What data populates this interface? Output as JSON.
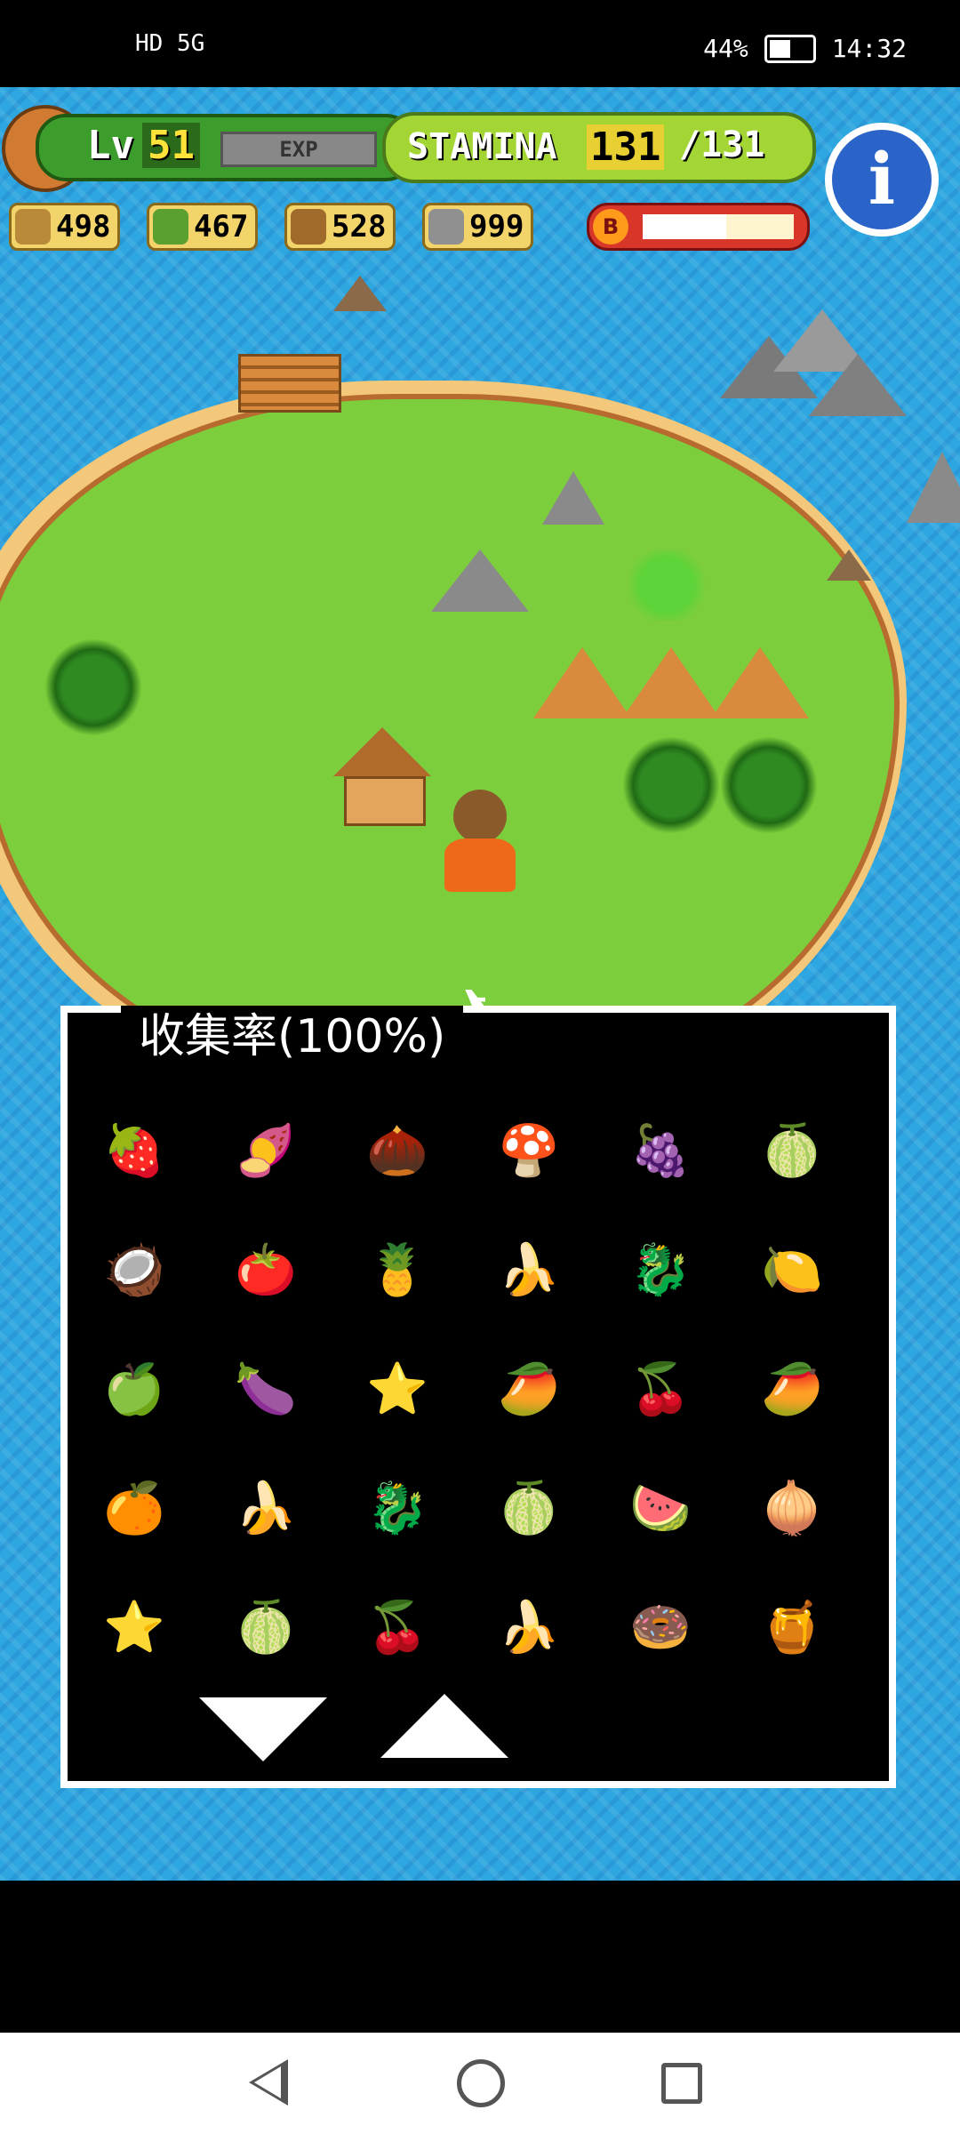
{
  "status_bar": {
    "left_indicators": "HD 5G",
    "battery": "44%",
    "time": "14:32"
  },
  "hud": {
    "level_label": "Lv",
    "level_value": "51",
    "exp_label": "EXP",
    "stamina_label": "STAMINA",
    "stamina_current": "131",
    "stamina_max": "/131",
    "boost_letter": "B",
    "boost_fill_fraction": 0.55,
    "resources": [
      {
        "name": "branch-icon",
        "value": "498",
        "color": "#b98a3a"
      },
      {
        "name": "leaf-icon",
        "value": "467",
        "color": "#5aa030"
      },
      {
        "name": "nut-icon",
        "value": "528",
        "color": "#a06a2a"
      },
      {
        "name": "stone-icon",
        "value": "999",
        "color": "#909090"
      }
    ],
    "info_symbol": "i"
  },
  "collection": {
    "title": "收集率(100%)",
    "items": [
      "🍓",
      "🍠",
      "🌰",
      "🍄",
      "🍇",
      "🍈",
      "🥥",
      "🍅",
      "🍍",
      "🍌",
      "🐉",
      "🍋",
      "🍏",
      "🍆",
      "⭐",
      "🥭",
      "🍒",
      "🥭",
      "🍊",
      "🍌",
      "🐉",
      "🍈",
      "🍉",
      "🧅",
      "⭐",
      "🍈",
      "🍒",
      "🍌",
      "🍩",
      "🍯"
    ]
  },
  "colors": {
    "water": "#2ea6e0",
    "grass": "#7cce3c",
    "panel_bg": "#000000",
    "panel_border": "#ffffff"
  }
}
